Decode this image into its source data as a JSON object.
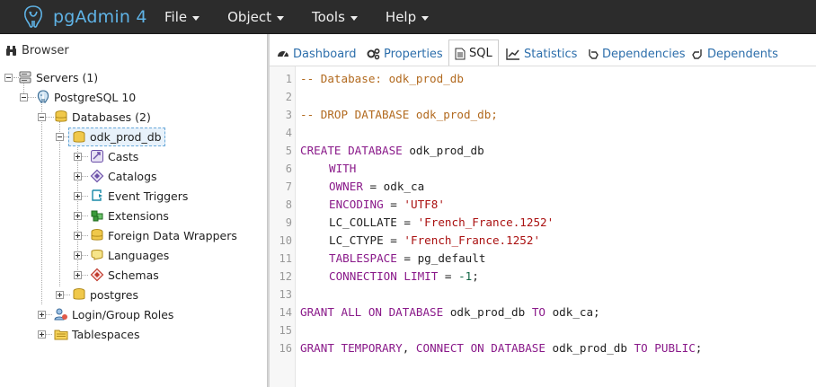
{
  "app": {
    "title": "pgAdmin 4"
  },
  "menu": [
    {
      "label": "File"
    },
    {
      "label": "Object"
    },
    {
      "label": "Tools"
    },
    {
      "label": "Help"
    }
  ],
  "browser": {
    "title": "Browser",
    "tree": {
      "servers": "Servers (1)",
      "server": "PostgreSQL 10",
      "databases": "Databases (2)",
      "db_selected": "odk_prod_db",
      "children": [
        "Casts",
        "Catalogs",
        "Event Triggers",
        "Extensions",
        "Foreign Data Wrappers",
        "Languages",
        "Schemas"
      ],
      "db_other": "postgres",
      "login_roles": "Login/Group Roles",
      "tablespaces": "Tablespaces"
    }
  },
  "tabs": [
    {
      "label": "Dashboard",
      "icon": "dashboard-icon"
    },
    {
      "label": "Properties",
      "icon": "properties-icon"
    },
    {
      "label": "SQL",
      "icon": "sql-file-icon",
      "active": true
    },
    {
      "label": "Statistics",
      "icon": "statistics-icon"
    },
    {
      "label": "Dependencies",
      "icon": "dependencies-icon"
    },
    {
      "label": "Dependents",
      "icon": "dependents-icon"
    }
  ],
  "sql": {
    "line_numbers": [
      "1",
      "2",
      "3",
      "4",
      "5",
      "6",
      "7",
      "8",
      "9",
      "10",
      "11",
      "12",
      "13",
      "14",
      "15",
      "16"
    ],
    "l1": "-- Database: odk_prod_db",
    "l3": "-- DROP DATABASE odk_prod_db;",
    "l5_kw": "CREATE DATABASE",
    "l5_name": " odk_prod_db",
    "l6": "WITH",
    "l7_kw": "OWNER",
    "l7_rest": " = odk_ca",
    "l8_kw": "ENCODING",
    "l8_eq": " = ",
    "l8_str": "'UTF8'",
    "l9_rest": "LC_COLLATE = ",
    "l9_str": "'French_France.1252'",
    "l10_rest": "LC_CTYPE = ",
    "l10_str": "'French_France.1252'",
    "l11_kw": "TABLESPACE",
    "l11_rest": " = pg_default",
    "l12_kw": "CONNECTION LIMIT",
    "l12_eq": " = ",
    "l12_num": "-1",
    "l12_end": ";",
    "l14_kw1": "GRANT ALL ON DATABASE",
    "l14_name": " odk_prod_db ",
    "l14_kw2": "TO",
    "l14_end": " odk_ca;",
    "l16_kw1": "GRANT TEMPORARY",
    "l16_p1": ", ",
    "l16_kw2": "CONNECT ON DATABASE",
    "l16_name": " odk_prod_db ",
    "l16_kw3": "TO PUBLIC",
    "l16_end": ";"
  },
  "colors": {
    "navbar": "#2c2c2c",
    "brand": "#5fb3e6",
    "link": "#2c6eab",
    "comment": "#b26a1f",
    "keyword": "#8a1a8a",
    "string": "#a11"
  }
}
